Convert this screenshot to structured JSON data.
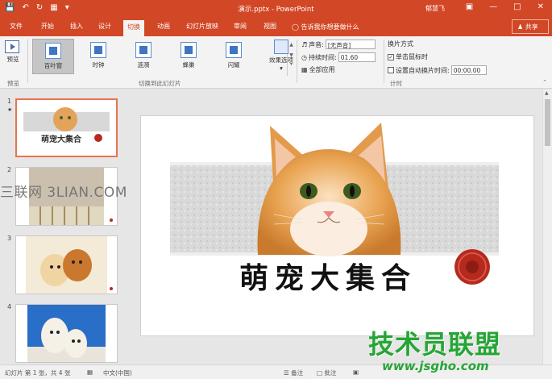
{
  "titlebar": {
    "title": "演示.pptx - PowerPoint",
    "user": "郁慧飞",
    "qat": [
      "save-icon",
      "undo-icon",
      "redo-icon",
      "start-from-beginning-icon",
      "customize-icon"
    ],
    "win_buttons": [
      "ribbon-display-icon",
      "minimize-icon",
      "maximize-icon",
      "close-icon"
    ]
  },
  "tabs": [
    "文件",
    "开始",
    "插入",
    "设计",
    "切换",
    "动画",
    "幻灯片放映",
    "审阅",
    "视图"
  ],
  "active_tab": "切换",
  "tellme": "告诉我你想要做什么",
  "share": "共享",
  "ribbon": {
    "preview": {
      "label": "预览",
      "group": "预览"
    },
    "transitions_group": "切换到此幻灯片",
    "effects": [
      "百叶窗",
      "时钟",
      "涟漪",
      "蜂巢",
      "闪耀"
    ],
    "selected_effect": "百叶窗",
    "effect_options": "效果选项",
    "timing_group": "计时",
    "sound_label": "声音:",
    "sound_value": "[无声音]",
    "duration_label": "持续时间:",
    "duration_value": "01.60",
    "apply_all": "全部应用",
    "advance_header": "换片方式",
    "on_click_label": "单击鼠标时",
    "on_click_checked": true,
    "after_label": "设置自动换片时间:",
    "after_value": "00:00.00"
  },
  "thumbnails": [
    {
      "num": "1",
      "star": "★",
      "caption": "萌宠大集合"
    },
    {
      "num": "2",
      "star": ""
    },
    {
      "num": "3",
      "star": ""
    },
    {
      "num": "4",
      "star": ""
    }
  ],
  "slide": {
    "title": "萌宠大集合"
  },
  "statusbar": {
    "slide_info": "幻灯片 第 1 张，共 4 张",
    "language": "中文(中国)",
    "notes": "备注",
    "comments": "批注"
  },
  "watermarks": {
    "top": "三联网 3LIAN.COM",
    "bottom_big": "技术员联盟",
    "bottom_url": "www.jsgho.com"
  },
  "colors": {
    "accent": "#d24726",
    "watermark_green": "#26a535",
    "selection_border": "#e8734f"
  }
}
